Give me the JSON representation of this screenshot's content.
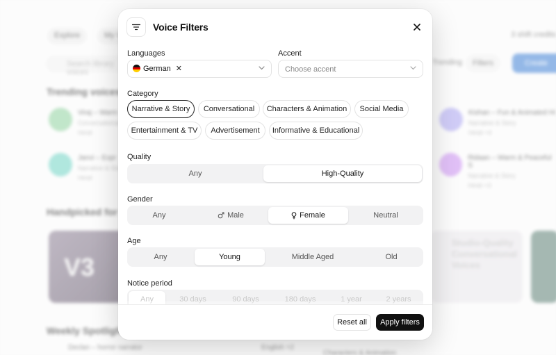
{
  "background": {
    "nav": [
      "Explore",
      "My V"
    ],
    "credits": "3 shift credits",
    "search_placeholder": "Search library voices",
    "trending_label": "Trending",
    "filters_label": "Filters",
    "create_label": "Create",
    "sections": {
      "trending": "Trending voices",
      "handpicked": "Handpicked for you",
      "weekly": "Weekly Spotlight"
    },
    "voices": [
      {
        "name": "Viraj – Warm",
        "sub": "Conversational",
        "lang": "Hindi"
      },
      {
        "name": "Janvi – Expr",
        "sub": "Narrative & Story",
        "lang": "Hindi"
      },
      {
        "name": "Kishan – Fun & Animated Hi",
        "sub": "Narrative & Story",
        "lang": "Hindi +4"
      },
      {
        "name": "Ridaan – Warm & Peaceful S",
        "sub": "Narrative & Story",
        "lang": "Hindi +3"
      }
    ],
    "cards": [
      {
        "text": "V3"
      },
      {
        "text": "Studio-Quality Conversational Voices"
      }
    ],
    "weekly_rows": [
      {
        "name": "Declan – horror narrator",
        "lang": "English +2",
        "category": "Characters & Animation"
      }
    ]
  },
  "modal": {
    "title": "Voice Filters",
    "languages": {
      "label": "Languages",
      "selected": "German"
    },
    "accent": {
      "label": "Accent",
      "placeholder": "Choose accent"
    },
    "category": {
      "label": "Category",
      "options": [
        {
          "label": "Narrative & Story",
          "selected": true
        },
        {
          "label": "Conversational",
          "selected": false
        },
        {
          "label": "Characters & Animation",
          "selected": false
        },
        {
          "label": "Social Media",
          "selected": false
        },
        {
          "label": "Entertainment & TV",
          "selected": false
        },
        {
          "label": "Advertisement",
          "selected": false
        },
        {
          "label": "Informative & Educational",
          "selected": false
        }
      ]
    },
    "quality": {
      "label": "Quality",
      "options": [
        "Any",
        "High-Quality"
      ],
      "active": "High-Quality"
    },
    "gender": {
      "label": "Gender",
      "options": [
        "Any",
        "Male",
        "Female",
        "Neutral"
      ],
      "active": "Female"
    },
    "age": {
      "label": "Age",
      "options": [
        "Any",
        "Young",
        "Middle Aged",
        "Old"
      ],
      "active": "Young"
    },
    "notice_period": {
      "label": "Notice period",
      "options": [
        "Any",
        "30 days",
        "90 days",
        "180 days",
        "1 year",
        "2 years"
      ],
      "active": "Any"
    },
    "footer": {
      "reset": "Reset all",
      "apply": "Apply filters"
    }
  },
  "colors": {
    "primary_button": "#111111",
    "create_button": "#3d7fd4",
    "selected_border": "#222222"
  }
}
